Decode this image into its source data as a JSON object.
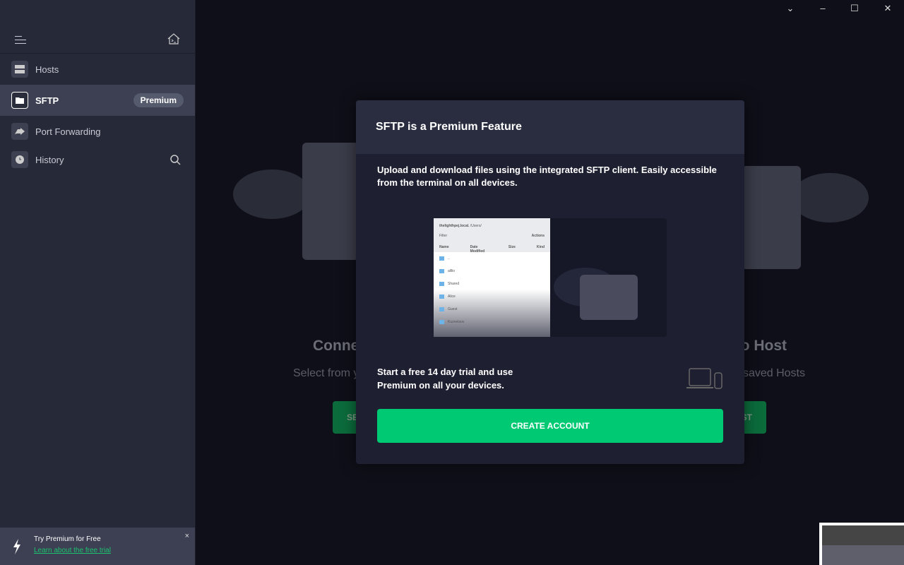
{
  "window": {
    "controls": [
      "chevron-down",
      "minimize",
      "maximize",
      "close"
    ]
  },
  "sidebar": {
    "items": [
      {
        "label": "Hosts",
        "icon": "server-icon"
      },
      {
        "label": "SFTP",
        "icon": "folder-icon",
        "badge": "Premium",
        "active": true
      },
      {
        "label": "Port Forwarding",
        "icon": "forward-icon"
      },
      {
        "label": "History",
        "icon": "clock-icon"
      }
    ],
    "promo": {
      "title": "Try Premium for Free",
      "link": "Learn about the free trial",
      "close": "×"
    }
  },
  "background": {
    "left": {
      "title": "Connect to Host",
      "subtitle": "Select from your saved Hosts",
      "button": "SELECT HOST"
    },
    "right": {
      "title": "Connect to Host",
      "subtitle": "Select from your saved Hosts",
      "button": "SELECT HOST"
    }
  },
  "modal": {
    "title": "SFTP is a Premium Feature",
    "description": "Upload and download files using the integrated SFTP client. Easily accessible from the terminal on all devices.",
    "preview": {
      "host": "thelighthpej.local.",
      "path": "/Users/",
      "filter": "Filter",
      "actions": "Actions",
      "columns": [
        "Name",
        "Date Modified",
        "Size",
        "Kind"
      ],
      "rows": [
        {
          "name": ".."
        },
        {
          "name": "alllio"
        },
        {
          "name": "Shared"
        },
        {
          "name": "Alice"
        },
        {
          "name": "Guest"
        },
        {
          "name": "Kuznetsov"
        }
      ]
    },
    "trial_text": "Start a free 14 day trial and use Premium on all your devices.",
    "cta": "CREATE ACCOUNT"
  },
  "colors": {
    "accent": "#00c974",
    "link": "#1dc270"
  }
}
